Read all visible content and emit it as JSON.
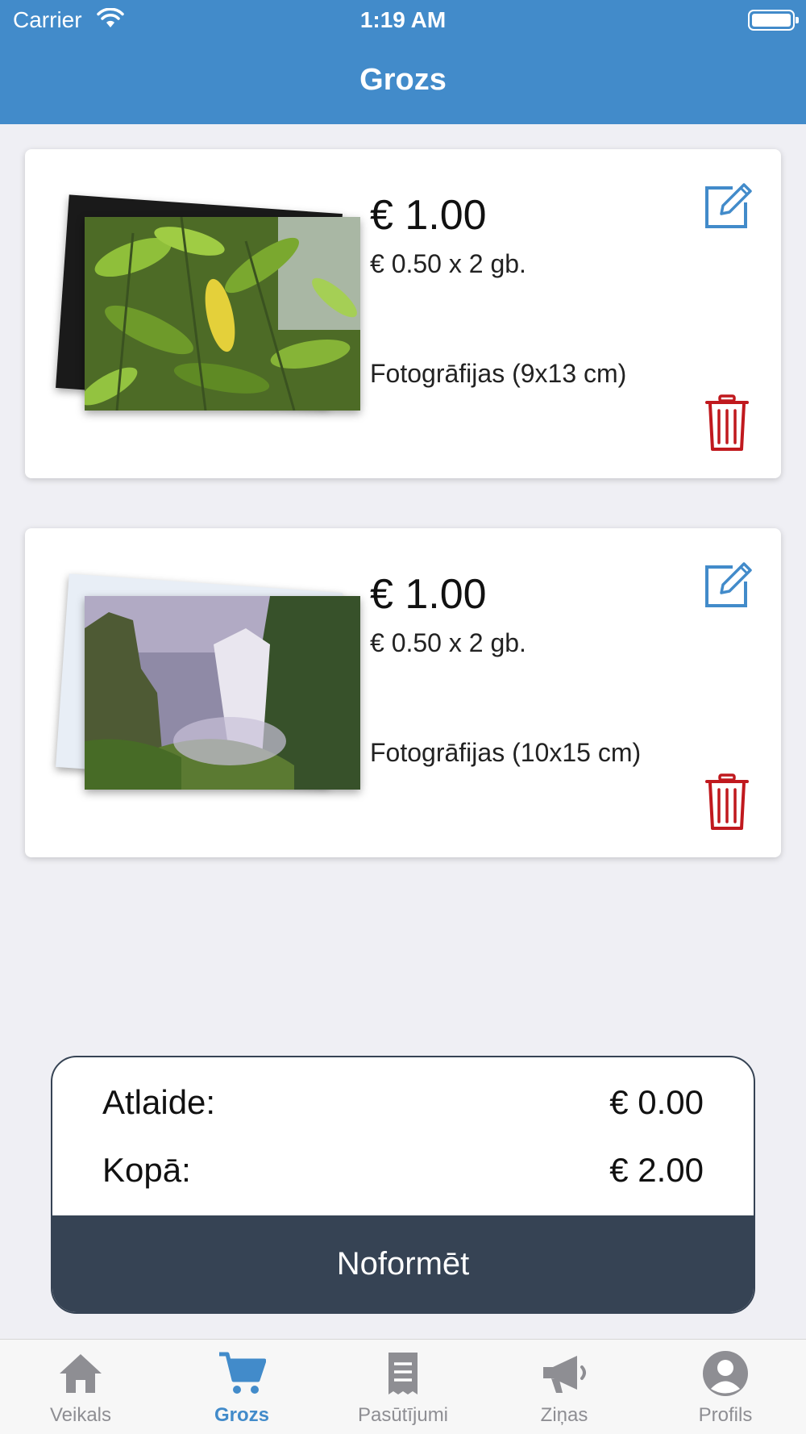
{
  "status_bar": {
    "carrier": "Carrier",
    "time": "1:19 AM"
  },
  "header": {
    "title": "Grozs"
  },
  "cart": {
    "items": [
      {
        "price": "€ 1.00",
        "unit_line": "€ 0.50 x 2 gb.",
        "product": "Fotogrāfijas (9x13 cm)",
        "thumbnail": "leaves-photo"
      },
      {
        "price": "€ 1.00",
        "unit_line": "€ 0.50 x 2 gb.",
        "product": "Fotogrāfijas (10x15 cm)",
        "thumbnail": "waterfall-photo"
      }
    ]
  },
  "summary": {
    "discount_label": "Atlaide:",
    "discount_value": "€ 0.00",
    "total_label": "Kopā:",
    "total_value": "€ 2.00",
    "checkout_label": "Noformēt"
  },
  "tabbar": {
    "items": [
      {
        "label": "Veikals",
        "icon": "home-icon"
      },
      {
        "label": "Grozs",
        "icon": "cart-icon",
        "active": true
      },
      {
        "label": "Pasūtījumi",
        "icon": "receipt-icon"
      },
      {
        "label": "Ziņas",
        "icon": "megaphone-icon"
      },
      {
        "label": "Profils",
        "icon": "profile-icon"
      }
    ]
  },
  "colors": {
    "header": "#428bca",
    "accent": "#428bca",
    "delete": "#c0191e",
    "checkout_bg": "#364354",
    "background": "#efeff4"
  }
}
